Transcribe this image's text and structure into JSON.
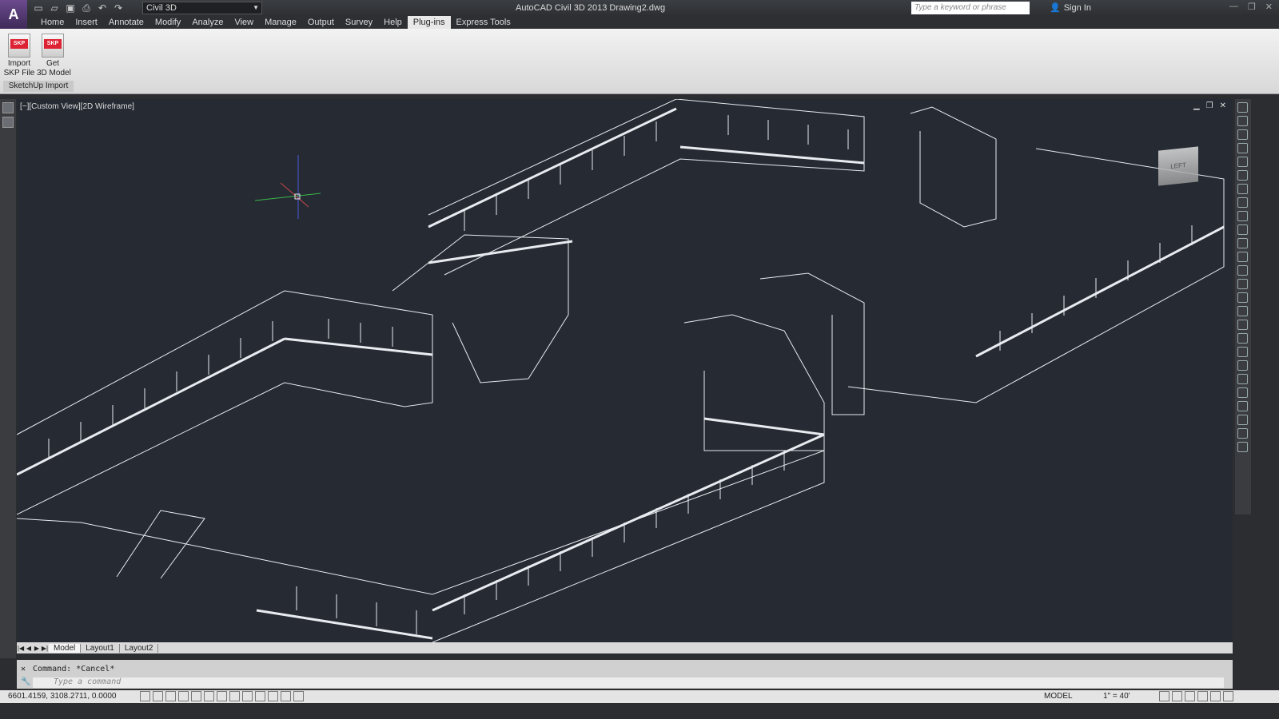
{
  "titlebar": {
    "app_glyph": "A",
    "workspace": "Civil 3D",
    "title": "AutoCAD Civil 3D 2013   Drawing2.dwg",
    "search_placeholder": "Type a keyword or phrase",
    "signin": "Sign In"
  },
  "menu": [
    {
      "label": "Home"
    },
    {
      "label": "Insert"
    },
    {
      "label": "Annotate"
    },
    {
      "label": "Modify"
    },
    {
      "label": "Analyze"
    },
    {
      "label": "View"
    },
    {
      "label": "Manage"
    },
    {
      "label": "Output"
    },
    {
      "label": "Survey"
    },
    {
      "label": "Help"
    },
    {
      "label": "Plug-ins",
      "active": true
    },
    {
      "label": "Express Tools"
    }
  ],
  "ribbon": {
    "import_label": "Import\nSKP File",
    "get_label": "Get\n3D Model",
    "panel_label": "SketchUp Import"
  },
  "viewport": {
    "label": "[−][Custom View][2D Wireframe]",
    "viewcube_face": "LEFT"
  },
  "tabs": [
    "Model",
    "Layout1",
    "Layout2"
  ],
  "command": {
    "history": "Command: *Cancel*",
    "placeholder": "Type a command"
  },
  "status": {
    "coords": "6601.4159, 3108.2711, 0.0000",
    "model": "MODEL",
    "scale": "1\" = 40'"
  },
  "colors": {
    "viewport_bg": "#252a33",
    "ribbon_bg": "#e8e8e8",
    "wire": "#e8ecf0"
  }
}
